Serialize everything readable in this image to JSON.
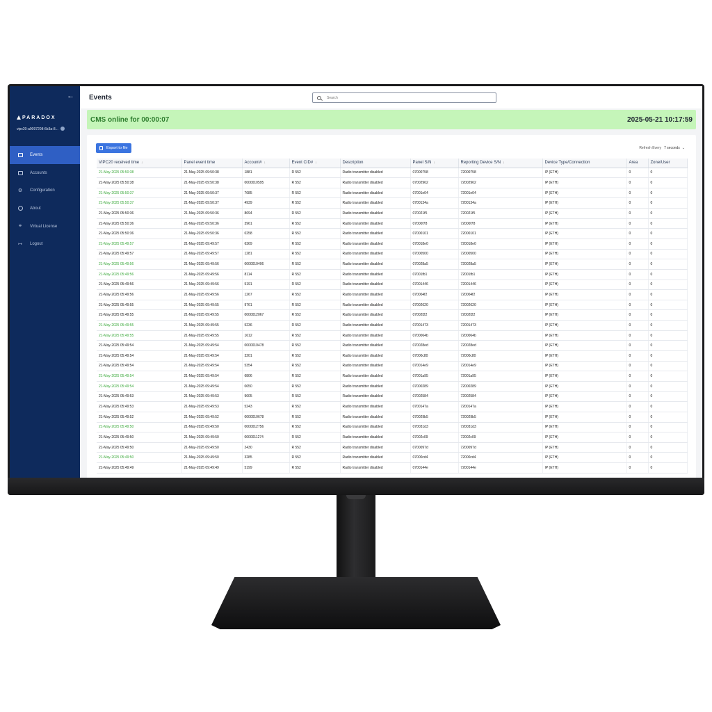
{
  "sidebar": {
    "brand": "PARADOX",
    "device_id": "vipc20-a9097208-6b3a-8...",
    "items": [
      {
        "label": "Events",
        "icon": "events-icon",
        "active": true
      },
      {
        "label": "Accounts",
        "icon": "accounts-icon",
        "active": false
      },
      {
        "label": "Configuration",
        "icon": "gear-icon",
        "active": false
      },
      {
        "label": "About",
        "icon": "info-icon",
        "active": false
      },
      {
        "label": "Virtual License",
        "icon": "key-icon",
        "active": false
      },
      {
        "label": "Logout",
        "icon": "logout-icon",
        "active": false
      }
    ]
  },
  "header": {
    "title": "Events",
    "search_placeholder": "Search"
  },
  "status": {
    "cms_online": "CMS online for 00:00:07",
    "datetime": "2025-05-21 10:17:59",
    "accent_color": "#c5f5b9"
  },
  "toolbar": {
    "export_label": "Export to file",
    "refresh_label": "Refresh Every",
    "refresh_value": "7 seconds"
  },
  "table": {
    "columns": [
      "VIPC20 received time",
      "Panel event time",
      "Account#",
      "Event CID#",
      "Description",
      "Panel S/N",
      "Reporting Device S/N",
      "Device Type/Connection",
      "Area",
      "Zone/User"
    ],
    "rows": [
      {
        "green": true,
        "cells": [
          "21-May-2025 05:50:38",
          "21-May-2025 09:50:38",
          "1881",
          "R 552",
          "Radio transmitter disabled",
          "07000758",
          "72000758",
          "IP (ETH)",
          "0",
          "0"
        ]
      },
      {
        "green": false,
        "cells": [
          "21-May-2025 05:50:38",
          "21-May-2025 09:50:38",
          "0000010595",
          "R 552",
          "Radio transmitter disabled",
          "07002962",
          "72002962",
          "IP (ETH)",
          "0",
          "0"
        ]
      },
      {
        "green": true,
        "cells": [
          "21-May-2025 05:50:37",
          "21-May-2025 09:50:37",
          "7685",
          "R 552",
          "Radio transmitter disabled",
          "07001e04",
          "72001e04",
          "IP (ETH)",
          "0",
          "0"
        ]
      },
      {
        "green": true,
        "cells": [
          "21-May-2025 05:50:37",
          "21-May-2025 09:50:37",
          "4939",
          "R 552",
          "Radio transmitter disabled",
          "0700134a",
          "7200134a",
          "IP (ETH)",
          "0",
          "0"
        ]
      },
      {
        "green": false,
        "cells": [
          "21-May-2025 05:50:36",
          "21-May-2025 09:50:36",
          "8694",
          "R 552",
          "Radio transmitter disabled",
          "070021f5",
          "720021f5",
          "IP (ETH)",
          "0",
          "0"
        ]
      },
      {
        "green": false,
        "cells": [
          "21-May-2025 05:50:36",
          "21-May-2025 09:50:36",
          "3961",
          "R 552",
          "Radio transmitter disabled",
          "07000f78",
          "72000f78",
          "IP (ETH)",
          "0",
          "0"
        ]
      },
      {
        "green": false,
        "cells": [
          "21-May-2025 05:50:36",
          "21-May-2025 09:50:36",
          "0258",
          "R 552",
          "Radio transmitter disabled",
          "07000101",
          "72000101",
          "IP (ETH)",
          "0",
          "0"
        ]
      },
      {
        "green": true,
        "cells": [
          "21-May-2025 05:49:57",
          "21-May-2025 09:49:57",
          "6369",
          "R 552",
          "Radio transmitter disabled",
          "070018e0",
          "720018e0",
          "IP (ETH)",
          "0",
          "0"
        ]
      },
      {
        "green": false,
        "cells": [
          "21-May-2025 05:49:57",
          "21-May-2025 09:49:57",
          "1281",
          "R 552",
          "Radio transmitter disabled",
          "07000500",
          "72000500",
          "IP (ETH)",
          "0",
          "0"
        ]
      },
      {
        "green": true,
        "cells": [
          "21-May-2025 05:49:56",
          "21-May-2025 09:49:56",
          "0000010406",
          "R 552",
          "Radio transmitter disabled",
          "070028a5",
          "720028a5",
          "IP (ETH)",
          "0",
          "0"
        ]
      },
      {
        "green": true,
        "cells": [
          "21-May-2025 05:49:56",
          "21-May-2025 09:49:56",
          "8114",
          "R 552",
          "Radio transmitter disabled",
          "07001fb1",
          "72001fb1",
          "IP (ETH)",
          "0",
          "0"
        ]
      },
      {
        "green": false,
        "cells": [
          "21-May-2025 05:49:56",
          "21-May-2025 09:49:56",
          "5191",
          "R 552",
          "Radio transmitter disabled",
          "07001446",
          "72001446",
          "IP (ETH)",
          "0",
          "0"
        ]
      },
      {
        "green": false,
        "cells": [
          "21-May-2025 05:49:56",
          "21-May-2025 09:49:56",
          "1267",
          "R 552",
          "Radio transmitter disabled",
          "070004f2",
          "720004f2",
          "IP (ETH)",
          "0",
          "0"
        ]
      },
      {
        "green": false,
        "cells": [
          "21-May-2025 05:49:55",
          "21-May-2025 09:49:55",
          "9761",
          "R 552",
          "Radio transmitter disabled",
          "07002620",
          "72002620",
          "IP (ETH)",
          "0",
          "0"
        ]
      },
      {
        "green": false,
        "cells": [
          "21-May-2025 05:49:55",
          "21-May-2025 09:49:55",
          "0000012067",
          "R 552",
          "Radio transmitter disabled",
          "07002f22",
          "72002f22",
          "IP (ETH)",
          "0",
          "0"
        ]
      },
      {
        "green": true,
        "cells": [
          "21-May-2025 05:49:55",
          "21-May-2025 09:49:55",
          "5236",
          "R 552",
          "Radio transmitter disabled",
          "07001473",
          "72001473",
          "IP (ETH)",
          "0",
          "0"
        ]
      },
      {
        "green": true,
        "cells": [
          "21-May-2025 05:49:55",
          "21-May-2025 09:49:55",
          "1612",
          "R 552",
          "Radio transmitter disabled",
          "0700064b",
          "7200064b",
          "IP (ETH)",
          "0",
          "0"
        ]
      },
      {
        "green": false,
        "cells": [
          "21-May-2025 05:49:54",
          "21-May-2025 09:49:54",
          "0000010478",
          "R 552",
          "Radio transmitter disabled",
          "070028ed",
          "720028ed",
          "IP (ETH)",
          "0",
          "0"
        ]
      },
      {
        "green": false,
        "cells": [
          "21-May-2025 05:49:54",
          "21-May-2025 09:49:54",
          "3201",
          "R 552",
          "Radio transmitter disabled",
          "07000c80",
          "72000c80",
          "IP (ETH)",
          "0",
          "0"
        ]
      },
      {
        "green": false,
        "cells": [
          "21-May-2025 05:49:54",
          "21-May-2025 09:49:54",
          "5354",
          "R 552",
          "Radio transmitter disabled",
          "070014e9",
          "720014e9",
          "IP (ETH)",
          "0",
          "0"
        ]
      },
      {
        "green": true,
        "cells": [
          "21-May-2025 05:49:54",
          "21-May-2025 09:49:54",
          "6806",
          "R 552",
          "Radio transmitter disabled",
          "07001a95",
          "72001a95",
          "IP (ETH)",
          "0",
          "0"
        ]
      },
      {
        "green": true,
        "cells": [
          "21-May-2025 05:49:54",
          "21-May-2025 09:49:54",
          "0650",
          "R 552",
          "Radio transmitter disabled",
          "07000289",
          "72000289",
          "IP (ETH)",
          "0",
          "0"
        ]
      },
      {
        "green": false,
        "cells": [
          "21-May-2025 05:49:53",
          "21-May-2025 09:49:53",
          "9605",
          "R 552",
          "Radio transmitter disabled",
          "07002584",
          "72002584",
          "IP (ETH)",
          "0",
          "0"
        ]
      },
      {
        "green": false,
        "cells": [
          "21-May-2025 05:49:53",
          "21-May-2025 09:49:53",
          "5243",
          "R 552",
          "Radio transmitter disabled",
          "0700147a",
          "7200147a",
          "IP (ETH)",
          "0",
          "0"
        ]
      },
      {
        "green": false,
        "cells": [
          "21-May-2025 05:49:52",
          "21-May-2025 09:49:52",
          "0000010678",
          "R 552",
          "Radio transmitter disabled",
          "070029b5",
          "720029b5",
          "IP (ETH)",
          "0",
          "0"
        ]
      },
      {
        "green": true,
        "cells": [
          "21-May-2025 05:49:50",
          "21-May-2025 09:49:50",
          "0000012756",
          "R 552",
          "Radio transmitter disabled",
          "070031d3",
          "720031d3",
          "IP (ETH)",
          "0",
          "0"
        ]
      },
      {
        "green": false,
        "cells": [
          "21-May-2025 05:49:50",
          "21-May-2025 09:49:50",
          "0000011274",
          "R 552",
          "Radio transmitter disabled",
          "07002c09",
          "72002c09",
          "IP (ETH)",
          "0",
          "0"
        ]
      },
      {
        "green": false,
        "cells": [
          "21-May-2025 05:49:50",
          "21-May-2025 09:49:50",
          "2430",
          "R 552",
          "Radio transmitter disabled",
          "0700097d",
          "7200097d",
          "IP (ETH)",
          "0",
          "0"
        ]
      },
      {
        "green": true,
        "cells": [
          "21-May-2025 05:49:50",
          "21-May-2025 09:49:50",
          "3285",
          "R 552",
          "Radio transmitter disabled",
          "07000cd4",
          "72000cd4",
          "IP (ETH)",
          "0",
          "0"
        ]
      },
      {
        "green": false,
        "cells": [
          "21-May-2025 05:49:49",
          "21-May-2025 09:49:49",
          "5199",
          "R 552",
          "Radio transmitter disabled",
          "0700144e",
          "7200144e",
          "IP (ETH)",
          "0",
          "0"
        ]
      }
    ]
  }
}
